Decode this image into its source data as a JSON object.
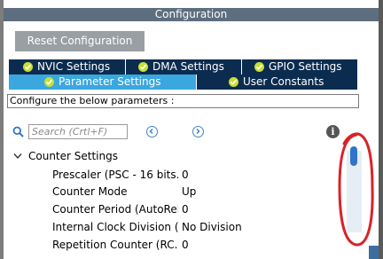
{
  "window": {
    "title": "Configuration"
  },
  "reset_button": {
    "label": "Reset Configuration"
  },
  "tabs": [
    {
      "label": "NVIC Settings",
      "active": false
    },
    {
      "label": "DMA Settings",
      "active": false
    },
    {
      "label": "GPIO Settings",
      "active": false
    },
    {
      "label": "Parameter Settings",
      "active": true
    },
    {
      "label": "User Constants",
      "active": false
    }
  ],
  "hint": "Configure the below parameters :",
  "search": {
    "placeholder": "Search (Crtl+F)",
    "value": ""
  },
  "icons": {
    "search": "search-icon",
    "prev": "chevron-left-circle-icon",
    "next": "chevron-right-circle-icon",
    "info": "info-icon",
    "check": "check-circle-icon",
    "group_toggle": "chevron-down-icon"
  },
  "info_glyph": "i",
  "group": {
    "label": "Counter Settings",
    "params": [
      {
        "name": "Prescaler (PSC - 16 bits...",
        "value": "0"
      },
      {
        "name": "Counter Mode",
        "value": "Up"
      },
      {
        "name": "Counter Period (AutoRel...",
        "value": "0"
      },
      {
        "name": "Internal Clock Division (...",
        "value": "No Division"
      },
      {
        "name": "Repetition Counter (RC...",
        "value": "0"
      }
    ]
  },
  "colors": {
    "title_bar": "#5d6e7e",
    "tab": "#0c2c4f",
    "tab_active": "#3aa7df",
    "check": "#c8e034",
    "reset_button": "#9a9fa3",
    "scroll_thumb": "#2f74c9",
    "annotation": "#d8232a"
  }
}
